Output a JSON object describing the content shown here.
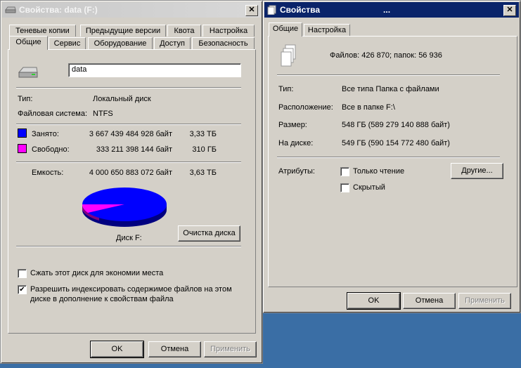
{
  "left": {
    "title": "Свойства: data (F:)",
    "tabs_row1": [
      "Теневые копии",
      "Предыдущие версии",
      "Квота",
      "Настройка"
    ],
    "tabs_row2": [
      "Общие",
      "Сервис",
      "Оборудование",
      "Доступ",
      "Безопасность"
    ],
    "name_value": "data",
    "type_label": "Тип:",
    "type_value": "Локальный диск",
    "fs_label": "Файловая система:",
    "fs_value": "NTFS",
    "used_label": "Занято:",
    "used_bytes": "3 667 439 484 928 байт",
    "used_size": "3,33 ТБ",
    "free_label": "Свободно:",
    "free_bytes": "333 211 398 144 байт",
    "free_size": "310 ГБ",
    "capacity_label": "Емкость:",
    "capacity_bytes": "4 000 650 883 072 байт",
    "capacity_size": "3,63 ТБ",
    "disk_label": "Диск F:",
    "cleanup_button": "Очистка диска",
    "compress_label": "Сжать этот диск для экономии места",
    "index_label_line1": "Разрешить индексировать содержимое файлов на этом",
    "index_label_line2": "диске в дополнение к свойствам файла",
    "index_checked": "✔",
    "ok": "OK",
    "cancel": "Отмена",
    "apply": "Применить",
    "colors": {
      "used": "#0000ff",
      "free": "#ff00ff"
    },
    "used_fraction": 0.9167
  },
  "right": {
    "title": "Свойства",
    "title_suffix": "...",
    "tabs": [
      "Общие",
      "Настройка"
    ],
    "summary": "Файлов: 426 870; папок: 56 936",
    "type_label": "Тип:",
    "type_value": "Все типа Папка с файлами",
    "location_label": "Расположение:",
    "location_value": "Все в папке F:\\",
    "size_label": "Размер:",
    "size_value": "548 ГБ (589 279 140 888 байт)",
    "ondisk_label": "На диске:",
    "ondisk_value": "549 ГБ (590 154 772 480 байт)",
    "attributes_label": "Атрибуты:",
    "readonly_label": "Только чтение",
    "hidden_label": "Скрытый",
    "other_button": "Другие...",
    "ok": "OK",
    "cancel": "Отмена",
    "apply": "Применить"
  }
}
